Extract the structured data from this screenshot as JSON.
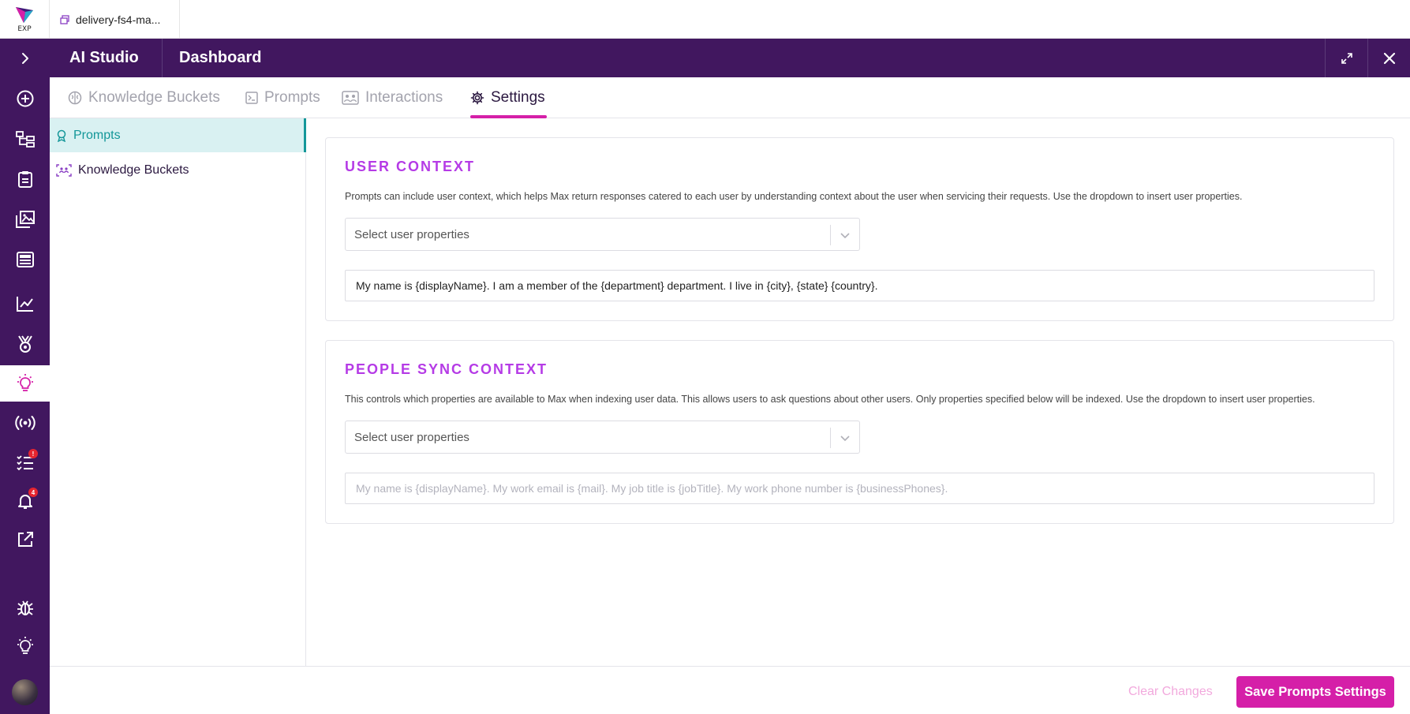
{
  "topbar": {
    "logo_text": "EXP",
    "doc_tab_label": "delivery-fs4-ma..."
  },
  "rail": {
    "items": [
      {
        "name": "chevron-right-icon"
      },
      {
        "name": "plus-circle-icon"
      },
      {
        "name": "hierarchy-icon"
      },
      {
        "name": "clipboard-icon"
      },
      {
        "name": "images-icon"
      },
      {
        "name": "news-icon"
      },
      {
        "name": "analytics-icon"
      },
      {
        "name": "award-icon"
      },
      {
        "name": "lightbulb-icon",
        "active": true
      },
      {
        "name": "broadcast-icon"
      },
      {
        "name": "tasks-icon",
        "badge": "!"
      },
      {
        "name": "bell-icon",
        "badge": "4"
      },
      {
        "name": "external-link-icon"
      },
      {
        "name": "bug-icon"
      },
      {
        "name": "lightbulb-icon"
      }
    ]
  },
  "header": {
    "app_title": "AI Studio",
    "page_title": "Dashboard"
  },
  "tabs": [
    {
      "label": "Knowledge Buckets",
      "active": false
    },
    {
      "label": "Prompts",
      "active": false
    },
    {
      "label": "Interactions",
      "active": false
    },
    {
      "label": "Settings",
      "active": true
    }
  ],
  "subnav": {
    "items": [
      {
        "label": "Prompts",
        "active": true
      },
      {
        "label": "Knowledge Buckets",
        "active": false
      }
    ]
  },
  "user_context": {
    "title": "USER CONTEXT",
    "description": "Prompts can include user context, which helps Max return responses catered to each user by understanding context about the user when servicing their requests. Use the dropdown to insert user properties.",
    "select_placeholder": "Select user properties",
    "template_value": "My name is {displayName}. I am a member of the {department} department. I live in {city}, {state} {country}."
  },
  "people_sync_context": {
    "title": "PEOPLE SYNC CONTEXT",
    "description": "This controls which properties are available to Max when indexing user data. This allows users to ask questions about other users. Only properties specified below will be indexed. Use the dropdown to insert user properties.",
    "select_placeholder": "Select user properties",
    "template_placeholder": "My name is {displayName}. My work email is {mail}. My job title is {jobTitle}. My work phone number is {businessPhones}."
  },
  "footer": {
    "clear_label": "Clear Changes",
    "save_label": "Save Prompts Settings"
  },
  "colors": {
    "brand_purple": "#41175f",
    "accent_magenta": "#d51fa8",
    "section_title": "#b53be6",
    "active_teal": "#149799",
    "active_teal_bg": "#d9f1f2"
  }
}
